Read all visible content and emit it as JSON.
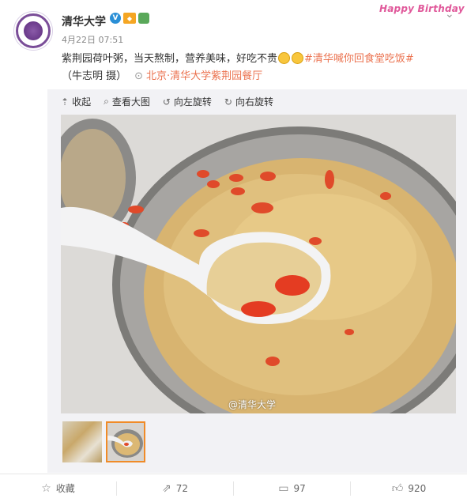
{
  "post": {
    "author": "清华大学",
    "badges": [
      "verified-badge",
      "vip-badge",
      "green-badge"
    ],
    "timestamp": "4月22日 07:51",
    "birthday_badge": "Happy Birthday",
    "text_main": "紫荆园荷叶粥，当天熬制，营养美味，好吃不贵",
    "topic": "#清华喊你回食堂吃饭#",
    "credit": "（牛志明 摄）",
    "location": "北京·清华大学紫荆园餐厅"
  },
  "media_toolbar": {
    "collapse": "收起",
    "view_large": "查看大图",
    "rotate_left": "向左旋转",
    "rotate_right": "向右旋转"
  },
  "image": {
    "watermark": "@清华大学"
  },
  "footer": {
    "favorite": "收藏",
    "forward_count": "72",
    "comment_count": "97",
    "like_count": "920"
  },
  "colors": {
    "topic": "#eb7350",
    "thumb_selected_border": "#f08b28"
  }
}
